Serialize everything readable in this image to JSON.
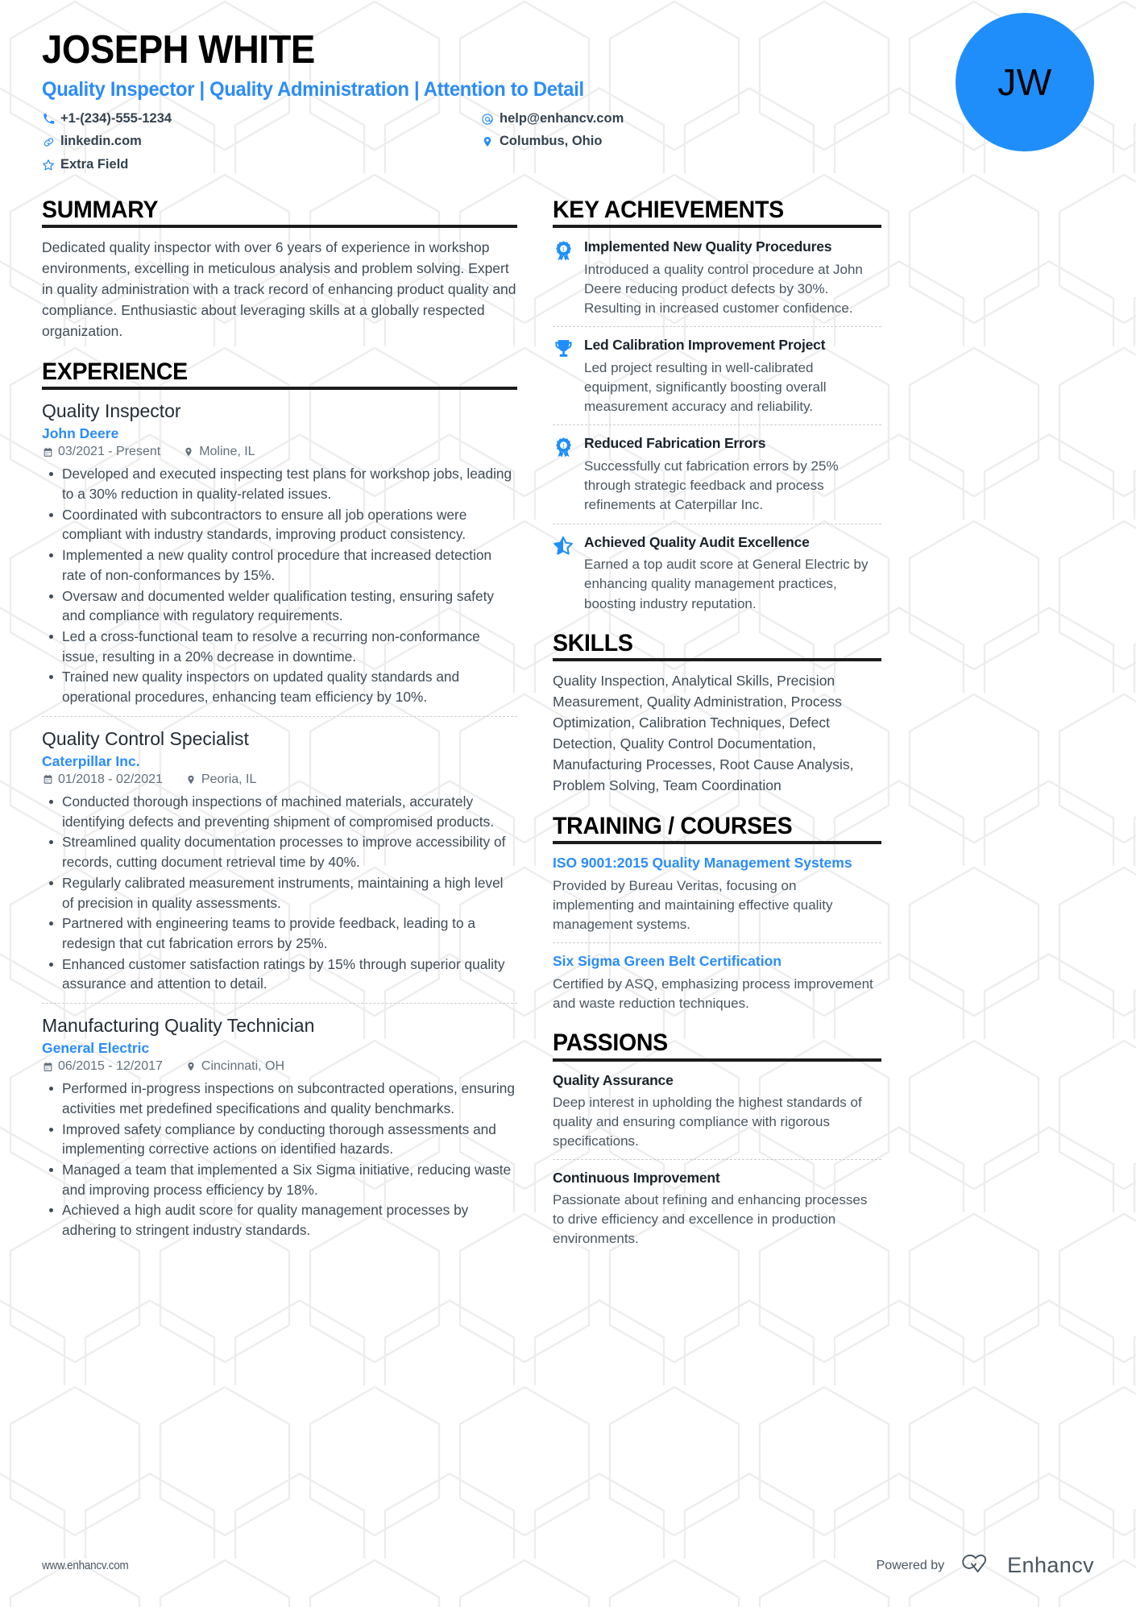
{
  "theme": {
    "accent": "#2b8cf9",
    "avatar_bg": "#1f8efb",
    "text": "#3f4b56",
    "heading": "#000000"
  },
  "header": {
    "name": "JOSEPH WHITE",
    "headline": "Quality Inspector | Quality Administration | Attention to Detail",
    "avatar_initials": "JW",
    "contacts": [
      {
        "icon": "phone-icon",
        "text": "+1-(234)-555-1234"
      },
      {
        "icon": "email-icon",
        "text": "help@enhancv.com"
      },
      {
        "icon": "link-icon",
        "text": "linkedin.com"
      },
      {
        "icon": "location-icon",
        "text": "Columbus, Ohio"
      },
      {
        "icon": "star-outline-icon",
        "text": "Extra Field"
      }
    ]
  },
  "summary": {
    "title": "SUMMARY",
    "text": "Dedicated quality inspector with over 6 years of experience in workshop environments, excelling in meticulous analysis and problem solving. Expert in quality administration with a track record of enhancing product quality and compliance. Enthusiastic about leveraging skills at a globally respected organization."
  },
  "experience": {
    "title": "EXPERIENCE",
    "jobs": [
      {
        "role": "Quality Inspector",
        "company": "John Deere",
        "dates": "03/2021 - Present",
        "location": "Moline, IL",
        "bullets": [
          "Developed and executed inspecting test plans for workshop jobs, leading to a 30% reduction in quality-related issues.",
          "Coordinated with subcontractors to ensure all job operations were compliant with industry standards, improving product consistency.",
          "Implemented a new quality control procedure that increased detection rate of non-conformances by 15%.",
          "Oversaw and documented welder qualification testing, ensuring safety and compliance with regulatory requirements.",
          "Led a cross-functional team to resolve a recurring non-conformance issue, resulting in a 20% decrease in downtime.",
          "Trained new quality inspectors on updated quality standards and operational procedures, enhancing team efficiency by 10%."
        ]
      },
      {
        "role": "Quality Control Specialist",
        "company": "Caterpillar Inc.",
        "dates": "01/2018 - 02/2021",
        "location": "Peoria, IL",
        "bullets": [
          "Conducted thorough inspections of machined materials, accurately identifying defects and preventing shipment of compromised products.",
          "Streamlined quality documentation processes to improve accessibility of records, cutting document retrieval time by 40%.",
          "Regularly calibrated measurement instruments, maintaining a high level of precision in quality assessments.",
          "Partnered with engineering teams to provide feedback, leading to a redesign that cut fabrication errors by 25%.",
          "Enhanced customer satisfaction ratings by 15% through superior quality assurance and attention to detail."
        ]
      },
      {
        "role": "Manufacturing Quality Technician",
        "company": "General Electric",
        "dates": "06/2015 - 12/2017",
        "location": "Cincinnati, OH",
        "bullets": [
          "Performed in-progress inspections on subcontracted operations, ensuring activities met predefined specifications and quality benchmarks.",
          "Improved safety compliance by conducting thorough assessments and implementing corrective actions on identified hazards.",
          "Managed a team that implemented a Six Sigma initiative, reducing waste and improving process efficiency by 18%.",
          "Achieved a high audit score for quality management processes by adhering to stringent industry standards."
        ]
      }
    ]
  },
  "key_achievements": {
    "title": "KEY ACHIEVEMENTS",
    "items": [
      {
        "icon": "ribbon-award-icon",
        "title": "Implemented New Quality Procedures",
        "desc": "Introduced a quality control procedure at John Deere reducing product defects by 30%. Resulting in increased customer confidence."
      },
      {
        "icon": "trophy-icon",
        "title": "Led Calibration Improvement Project",
        "desc": "Led project resulting in well-calibrated equipment, significantly boosting overall measurement accuracy and reliability."
      },
      {
        "icon": "ribbon-award-icon",
        "title": "Reduced Fabrication Errors",
        "desc": "Successfully cut fabrication errors by 25% through strategic feedback and process refinements at Caterpillar Inc."
      },
      {
        "icon": "half-star-icon",
        "title": "Achieved Quality Audit Excellence",
        "desc": "Earned a top audit score at General Electric by enhancing quality management practices, boosting industry reputation."
      }
    ]
  },
  "skills": {
    "title": "SKILLS",
    "text": "Quality Inspection, Analytical Skills, Precision Measurement, Quality Administration, Process Optimization, Calibration Techniques, Defect Detection, Quality Control Documentation, Manufacturing Processes, Root Cause Analysis, Problem Solving, Team Coordination"
  },
  "training": {
    "title": "TRAINING / COURSES",
    "items": [
      {
        "name": "ISO 9001:2015 Quality Management Systems",
        "desc": "Provided by Bureau Veritas, focusing on implementing and maintaining effective quality management systems."
      },
      {
        "name": "Six Sigma Green Belt Certification",
        "desc": "Certified by ASQ, emphasizing process improvement and waste reduction techniques."
      }
    ]
  },
  "passions": {
    "title": "PASSIONS",
    "items": [
      {
        "name": "Quality Assurance",
        "desc": "Deep interest in upholding the highest standards of quality and ensuring compliance with rigorous specifications."
      },
      {
        "name": "Continuous Improvement",
        "desc": "Passionate about refining and enhancing processes to drive efficiency and excellence in production environments."
      }
    ]
  },
  "footer": {
    "url": "www.enhancv.com",
    "powered_by": "Powered by",
    "brand": "Enhancv"
  }
}
